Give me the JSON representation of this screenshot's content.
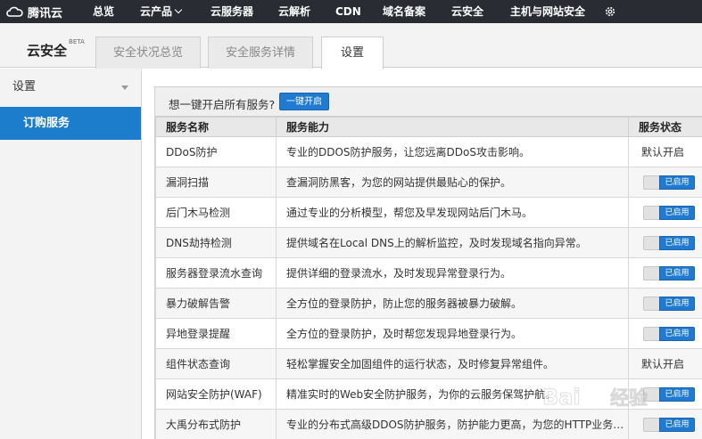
{
  "topnav": {
    "brand": "腾讯云",
    "items": [
      "总览",
      "云产品",
      "云服务器",
      "云解析",
      "CDN",
      "域名备案",
      "云安全",
      "主机与网站安全"
    ]
  },
  "header": {
    "title": "云安全",
    "badge": "BETA",
    "tabs": [
      "安全状况总览",
      "安全服务详情",
      "设置"
    ],
    "active_tab": "设置"
  },
  "sidebar": {
    "section": "设置",
    "items": [
      "订购服务"
    ]
  },
  "promo": {
    "text": "想一键开启所有服务?",
    "button": "一键开启"
  },
  "table": {
    "columns": [
      "服务名称",
      "服务能力",
      "服务状态"
    ],
    "rows": [
      {
        "name": "DDoS防护",
        "desc": "专业的DDOS防护服务，让您远离DDoS攻击影响。",
        "status": "默认开启"
      },
      {
        "name": "漏洞扫描",
        "desc": "查漏洞防黑客，为您的网站提供最贴心的保护。",
        "status": "已启用"
      },
      {
        "name": "后门木马检测",
        "desc": "通过专业的分析模型，帮您及早发现网站后门木马。",
        "status": "已启用"
      },
      {
        "name": "DNS劫持检测",
        "desc": "提供域名在Local DNS上的解析监控，及时发现域名指向异常。",
        "status": "已启用"
      },
      {
        "name": "服务器登录流水查询",
        "desc": "提供详细的登录流水，及时发现异常登录行为。",
        "status": "已启用"
      },
      {
        "name": "暴力破解告警",
        "desc": "全方位的登录防护，防止您的服务器被暴力破解。",
        "status": "已启用"
      },
      {
        "name": "异地登录提醒",
        "desc": "全方位的登录防护，及时帮您发现异地登录行为。",
        "status": "已启用"
      },
      {
        "name": "组件状态查询",
        "desc": "轻松掌握安全加固组件的运行状态，及时修复异常组件。",
        "status": "默认开启"
      },
      {
        "name": "网站安全防护(WAF)",
        "desc": "精准实时的Web安全防护服务，为你的云服务保驾护航。",
        "status": "已启用"
      },
      {
        "name": "大禹分布式防护",
        "desc": "专业的分布式高级DDOS防护服务，防护能力更高，为您的HTTP业务保驾护航。",
        "status": "已启用"
      }
    ]
  },
  "watermark": {
    "text": "Bai 经验"
  },
  "colors": {
    "topbar": "#292d33",
    "accent": "#1b7dcc",
    "button": "#1f7ad0"
  }
}
